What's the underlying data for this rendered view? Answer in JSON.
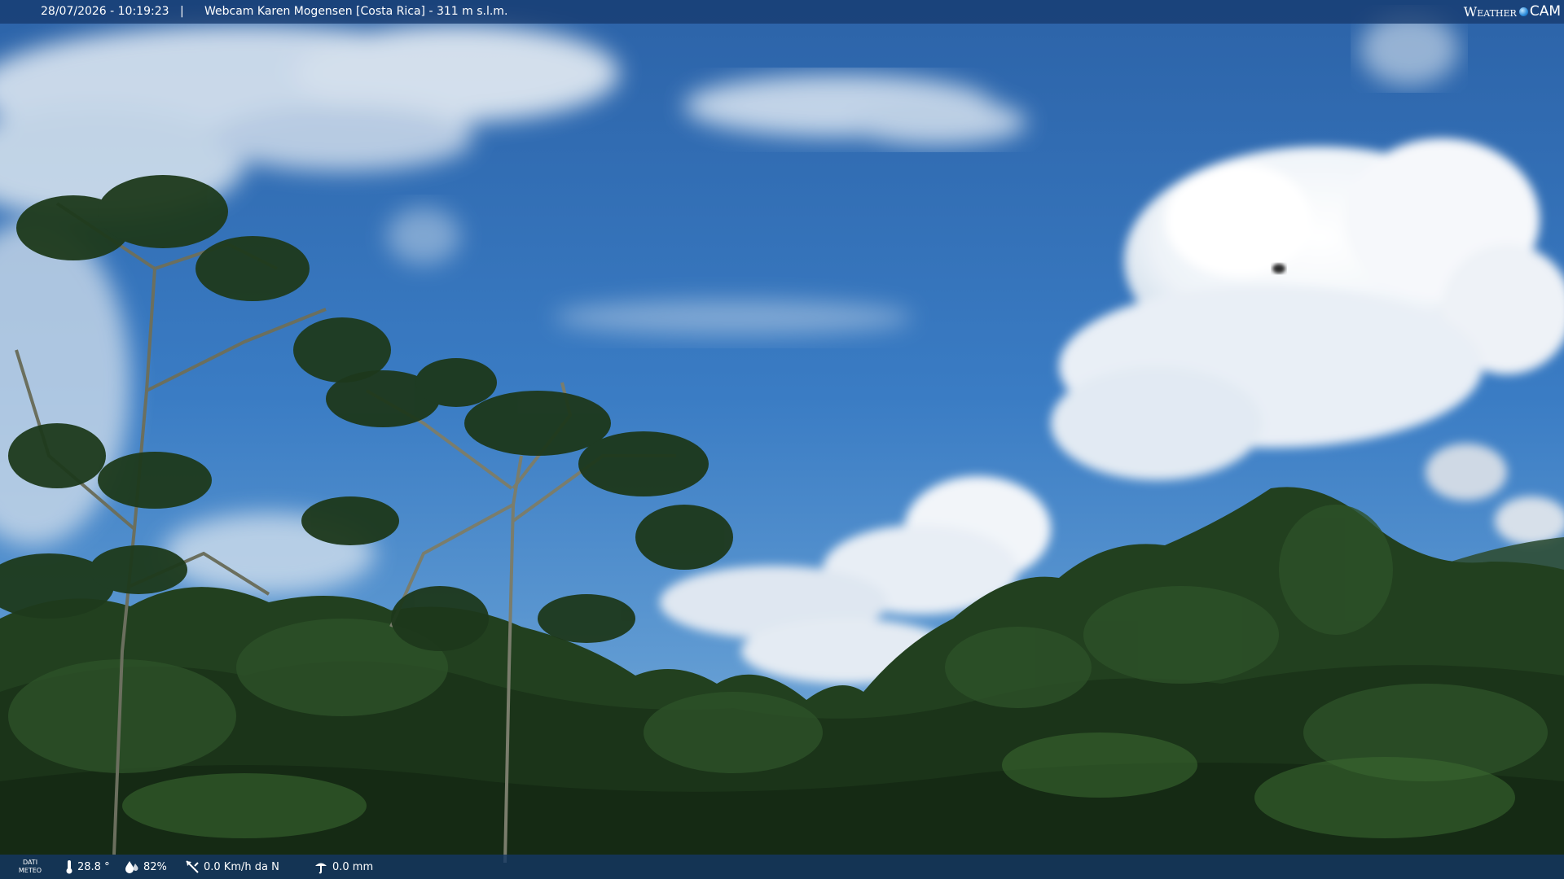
{
  "header": {
    "timestamp": "28/07/2026 - 10:19:23",
    "separator": "|",
    "camera_title": "Webcam Karen Mogensen [Costa Rica] - 311 m s.l.m.",
    "brand_weather": "Weather",
    "brand_cam": "CAM"
  },
  "footer": {
    "meteo_label_line1": "DATI",
    "meteo_label_line2": "METEO",
    "temperature": "28.8 °",
    "humidity": "82%",
    "wind": "0.0 Km/h da N",
    "rain": "0.0 mm"
  },
  "icons": {
    "temperature": "thermometer-icon",
    "humidity": "humidity-drop-icon",
    "wind": "wind-vane-icon",
    "rain": "rain-gauge-icon"
  },
  "colors": {
    "bar_background": "#163a6e",
    "sky": "#2f6fb3",
    "foliage": "#1f3a1e"
  }
}
